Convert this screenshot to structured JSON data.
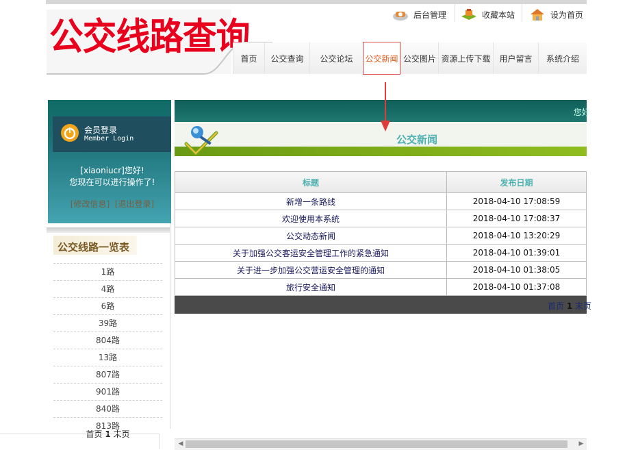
{
  "header": {
    "logo_text": "公交线路查询",
    "top_links": [
      {
        "label": "后台管理",
        "icon": "phone-icon"
      },
      {
        "label": "收藏本站",
        "icon": "favorite-icon"
      },
      {
        "label": "设为首页",
        "icon": "home-icon"
      }
    ],
    "nav": [
      {
        "label": "首页"
      },
      {
        "label": "公交查询"
      },
      {
        "label": "公交论坛"
      },
      {
        "label": "公交新闻",
        "active": true
      },
      {
        "label": "公交图片"
      },
      {
        "label": "资源上传下载"
      },
      {
        "label": "用户留言"
      },
      {
        "label": "系统介绍"
      }
    ]
  },
  "login": {
    "title": "会员登录",
    "subtitle": "Member Login",
    "welcome_line1": "[xiaoniucr]您好!",
    "welcome_line2": "您现在可以进行操作了!",
    "edit_info": "[修改信息]",
    "logout": "[退出登录]"
  },
  "routes": {
    "title": "公交线路一览表",
    "items": [
      "1路",
      "4路",
      "6路",
      "39路",
      "804路",
      "13路",
      "807路",
      "901路",
      "840路",
      "813路"
    ],
    "pager": {
      "first": "首页",
      "page": "1",
      "last": "末页"
    }
  },
  "main": {
    "band_text": "您好",
    "section_title": "公交新闻",
    "table": {
      "headers": [
        "标题",
        "发布日期"
      ],
      "rows": [
        {
          "title": "新增一条路线",
          "date": "2018-04-10 17:08:59"
        },
        {
          "title": "欢迎使用本系统",
          "date": "2018-04-10 17:08:37"
        },
        {
          "title": "公交动态新闻",
          "date": "2018-04-10 13:20:29"
        },
        {
          "title": "关于加强公交客运安全管理工作的紧急通知",
          "date": "2018-04-10 01:39:01"
        },
        {
          "title": "关于进一步加强公交营运安全管理的通知",
          "date": "2018-04-10 01:38:05"
        },
        {
          "title": "旅行安全通知",
          "date": "2018-04-10 01:37:08"
        }
      ]
    },
    "pager": {
      "first": "首页",
      "page": "1",
      "last": "末页"
    }
  },
  "colors": {
    "logo_red": "#e8001c",
    "teal": "#0f6b65",
    "accent_cyan": "#4fb1b1",
    "green_bar": "#8fbc1f",
    "active_nav": "#e05a1a"
  }
}
